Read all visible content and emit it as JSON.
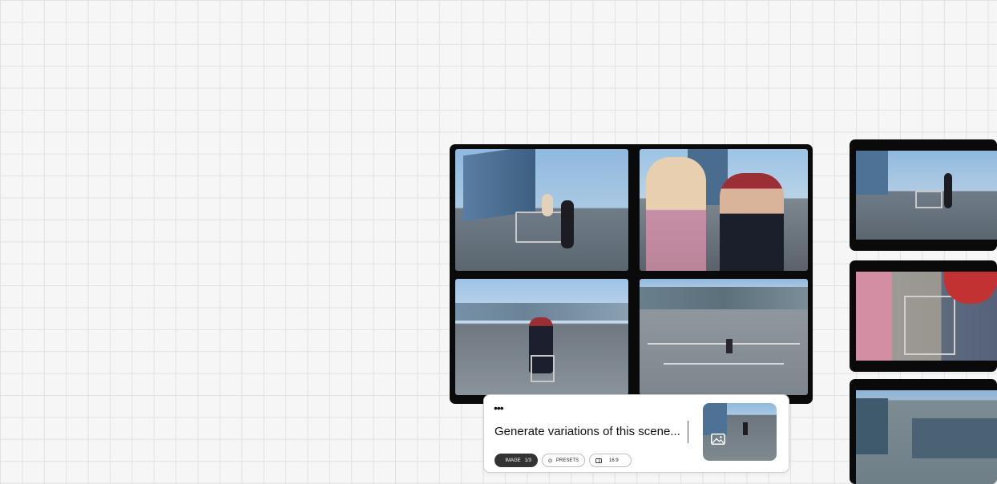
{
  "prompt": {
    "menu_dots": "•••",
    "text": "Generate variations of this scene...",
    "chips": {
      "image_label": "IMAGE",
      "image_count": "1/3",
      "presets_label": "PRESETS",
      "aspect_label": "16:9"
    }
  },
  "colors": {
    "canvas_bg": "#f6f6f6",
    "grid_line": "#e2e2e2",
    "frame_border": "#0a0a0a",
    "chip_dark": "#333333"
  },
  "icons": [
    "image-icon",
    "presets-icon",
    "aspect-ratio-icon",
    "image-placeholder-icon"
  ]
}
